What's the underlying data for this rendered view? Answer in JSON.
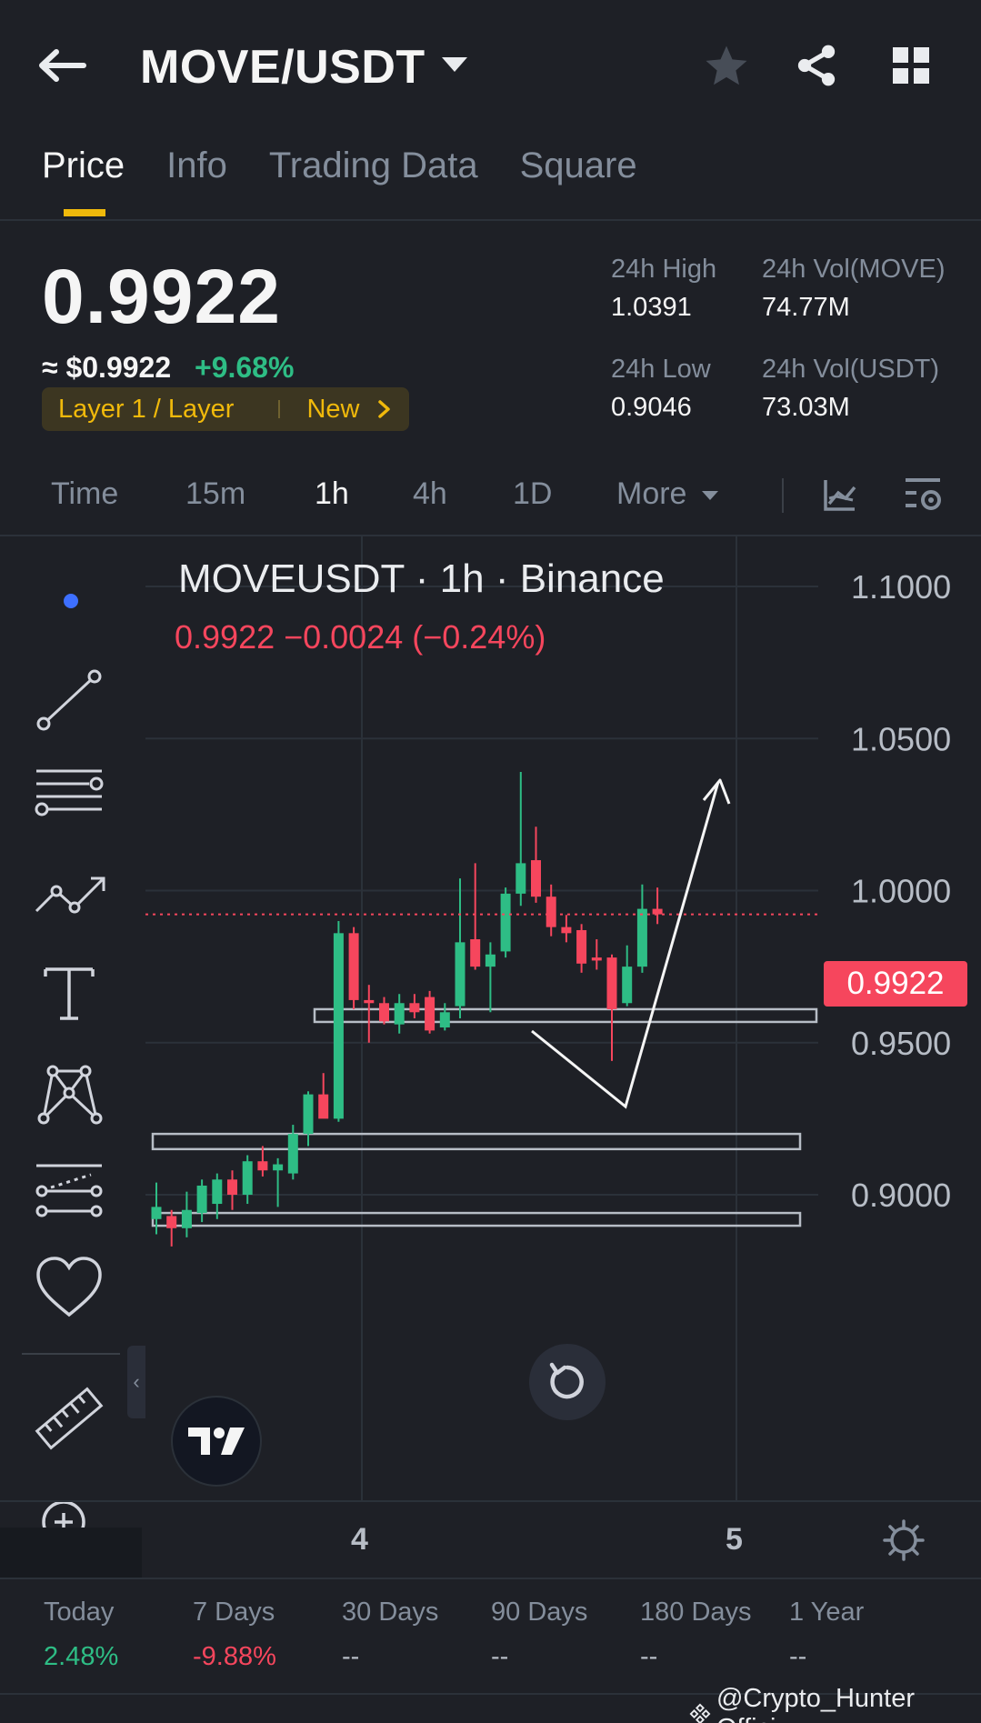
{
  "header": {
    "pair": "MOVE/USDT"
  },
  "tabs": [
    {
      "label": "Price",
      "active": true
    },
    {
      "label": "Info",
      "active": false
    },
    {
      "label": "Trading Data",
      "active": false
    },
    {
      "label": "Square",
      "active": false
    }
  ],
  "ticker": {
    "last_price": "0.9922",
    "approx_usd": "≈ $0.9922",
    "change_pct": "+9.68%",
    "tag_category": "Layer 1 / Layer",
    "tag_new": "New",
    "high_label": "24h High",
    "high_value": "1.0391",
    "low_label": "24h Low",
    "low_value": "0.9046",
    "vol_base_label": "24h Vol(MOVE)",
    "vol_base_value": "74.77M",
    "vol_quote_label": "24h Vol(USDT)",
    "vol_quote_value": "73.03M"
  },
  "intervals": {
    "time": "Time",
    "m15": "15m",
    "h1": "1h",
    "h4": "4h",
    "d1": "1D",
    "more": "More"
  },
  "chart": {
    "title": "MOVEUSDT · 1h · Binance",
    "ohlc_line": "0.9922  −0.0024 (−0.24%)",
    "last_badge": "0.9922",
    "date_labels": [
      "4",
      "5"
    ]
  },
  "chart_data": {
    "type": "candlestick",
    "ylim": [
      0.88,
      1.11
    ],
    "y_ticks": [
      "1.1000",
      "1.0500",
      "1.0000",
      "0.9500",
      "0.9000"
    ],
    "y_tick_values": [
      1.1,
      1.05,
      1.0,
      0.95,
      0.9
    ],
    "last_price": 0.9922,
    "candles": [
      {
        "o": 0.892,
        "h": 0.904,
        "l": 0.887,
        "c": 0.896
      },
      {
        "o": 0.893,
        "h": 0.895,
        "l": 0.883,
        "c": 0.889
      },
      {
        "o": 0.889,
        "h": 0.901,
        "l": 0.886,
        "c": 0.895
      },
      {
        "o": 0.894,
        "h": 0.905,
        "l": 0.891,
        "c": 0.903
      },
      {
        "o": 0.897,
        "h": 0.907,
        "l": 0.892,
        "c": 0.905
      },
      {
        "o": 0.905,
        "h": 0.908,
        "l": 0.895,
        "c": 0.9
      },
      {
        "o": 0.9,
        "h": 0.913,
        "l": 0.897,
        "c": 0.911
      },
      {
        "o": 0.911,
        "h": 0.916,
        "l": 0.906,
        "c": 0.908
      },
      {
        "o": 0.908,
        "h": 0.912,
        "l": 0.896,
        "c": 0.91
      },
      {
        "o": 0.907,
        "h": 0.923,
        "l": 0.905,
        "c": 0.92
      },
      {
        "o": 0.92,
        "h": 0.934,
        "l": 0.916,
        "c": 0.933
      },
      {
        "o": 0.933,
        "h": 0.94,
        "l": 0.926,
        "c": 0.925
      },
      {
        "o": 0.925,
        "h": 0.99,
        "l": 0.924,
        "c": 0.986
      },
      {
        "o": 0.986,
        "h": 0.988,
        "l": 0.961,
        "c": 0.964
      },
      {
        "o": 0.964,
        "h": 0.969,
        "l": 0.95,
        "c": 0.963
      },
      {
        "o": 0.963,
        "h": 0.965,
        "l": 0.956,
        "c": 0.957
      },
      {
        "o": 0.956,
        "h": 0.966,
        "l": 0.953,
        "c": 0.963
      },
      {
        "o": 0.963,
        "h": 0.966,
        "l": 0.958,
        "c": 0.96
      },
      {
        "o": 0.965,
        "h": 0.967,
        "l": 0.953,
        "c": 0.954
      },
      {
        "o": 0.955,
        "h": 0.963,
        "l": 0.954,
        "c": 0.96
      },
      {
        "o": 0.962,
        "h": 1.004,
        "l": 0.958,
        "c": 0.983
      },
      {
        "o": 0.984,
        "h": 1.009,
        "l": 0.974,
        "c": 0.975
      },
      {
        "o": 0.975,
        "h": 0.983,
        "l": 0.96,
        "c": 0.979
      },
      {
        "o": 0.98,
        "h": 1.001,
        "l": 0.978,
        "c": 0.999
      },
      {
        "o": 0.999,
        "h": 1.039,
        "l": 0.995,
        "c": 1.009
      },
      {
        "o": 1.01,
        "h": 1.021,
        "l": 0.996,
        "c": 0.998
      },
      {
        "o": 0.998,
        "h": 1.002,
        "l": 0.985,
        "c": 0.988
      },
      {
        "o": 0.988,
        "h": 0.992,
        "l": 0.983,
        "c": 0.986
      },
      {
        "o": 0.987,
        "h": 0.989,
        "l": 0.973,
        "c": 0.976
      },
      {
        "o": 0.978,
        "h": 0.984,
        "l": 0.974,
        "c": 0.977
      },
      {
        "o": 0.978,
        "h": 0.979,
        "l": 0.944,
        "c": 0.961
      },
      {
        "o": 0.963,
        "h": 0.982,
        "l": 0.962,
        "c": 0.975
      },
      {
        "o": 0.975,
        "h": 1.002,
        "l": 0.973,
        "c": 0.994
      },
      {
        "o": 0.994,
        "h": 1.001,
        "l": 0.989,
        "c": 0.9922
      }
    ],
    "zones": [
      {
        "from": 0.957,
        "to": 0.961
      },
      {
        "from": 0.915,
        "to": 0.92
      },
      {
        "from": 0.89,
        "to": 0.894
      }
    ]
  },
  "performance": [
    {
      "label": "Today",
      "value": "2.48%",
      "color": "#2ebd85"
    },
    {
      "label": "7 Days",
      "value": "-9.88%",
      "color": "#f6465d"
    },
    {
      "label": "30 Days",
      "value": "--",
      "color": "#b7bdc6"
    },
    {
      "label": "90 Days",
      "value": "--",
      "color": "#b7bdc6"
    },
    {
      "label": "180 Days",
      "value": "--",
      "color": "#b7bdc6"
    },
    {
      "label": "1 Year",
      "value": "--",
      "color": "#b7bdc6"
    }
  ],
  "watermark": "@Crypto_Hunter Offici...",
  "colors": {
    "up": "#2ebd85",
    "down": "#f6465d",
    "accent": "#f0b90b",
    "background": "#1e2026"
  }
}
